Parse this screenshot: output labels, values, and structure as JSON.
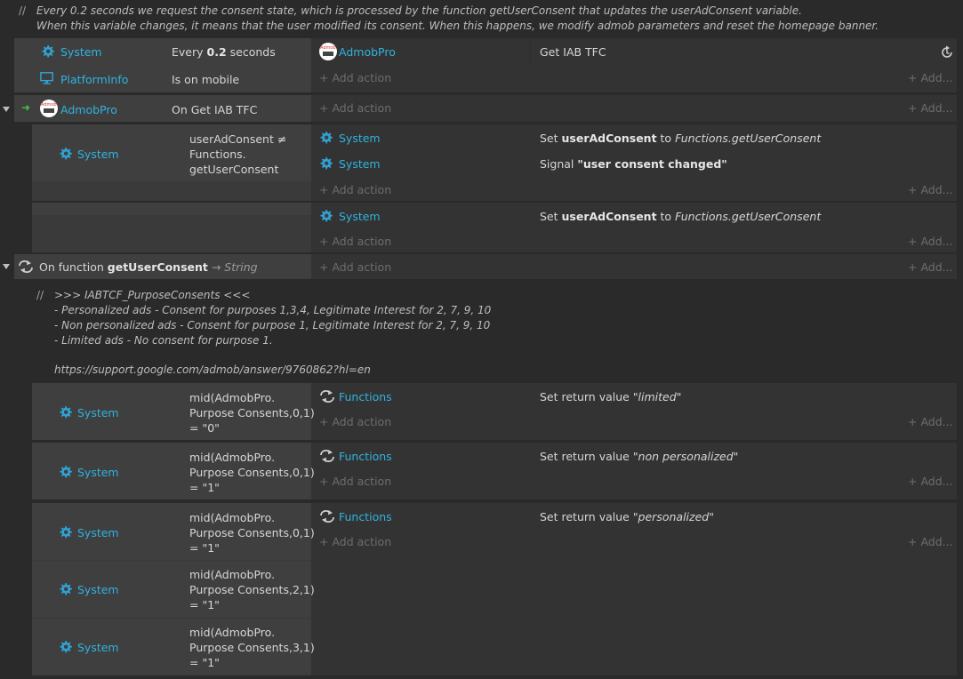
{
  "comment1": {
    "line1": "Every 0.2 seconds we request the consent state, which is processed by the function getUserConsent that updates the userAdConsent variable.",
    "line2": "When this variable changes, it means that the user modified its consent. When this happens, we modify admob parameters and reset the homepage banner."
  },
  "event1": {
    "cond1_obj": "System",
    "cond1_pre": "Every ",
    "cond1_val": "0.2",
    "cond1_post": " seconds",
    "cond2_obj": "PlatformInfo",
    "cond2_text": "Is on mobile",
    "action_obj": "AdmobPro",
    "action_text": "Get IAB TFC",
    "add_action": "Add action",
    "add_more": "Add..."
  },
  "event2": {
    "arrow": "➜",
    "cond_obj": "AdmobPro",
    "cond_text": "On Get IAB TFC",
    "add_action": "Add action",
    "add_more": "Add..."
  },
  "sub1": {
    "cond_obj": "System",
    "cond_l1": "userAdConsent ≠",
    "cond_l2": "Functions.",
    "cond_l3": "getUserConsent",
    "a1_obj": "System",
    "a1_pre": "Set ",
    "a1_var": "userAdConsent",
    "a1_mid": " to ",
    "a1_val": "Functions.getUserConsent",
    "a2_obj": "System",
    "a2_pre": "Signal ",
    "a2_val": "\"user consent changed\"",
    "add_action": "Add action",
    "add_more": "Add..."
  },
  "sub2": {
    "a1_obj": "System",
    "a1_pre": "Set ",
    "a1_var": "userAdConsent",
    "a1_mid": " to ",
    "a1_val": "Functions.getUserConsent",
    "add_action": "Add action",
    "add_more": "Add..."
  },
  "func": {
    "pre": "On function ",
    "name": "getUserConsent",
    "arrow": " → ",
    "type": "String",
    "add_action": "Add action",
    "add_more": "Add..."
  },
  "comment2": {
    "l1": ">>> IABTCF_PurposeConsents <<<",
    "l2": "- Personalized ads - Consent for purposes 1,3,4, Legitimate Interest for 2, 7, 9, 10",
    "l3": "- Non personalized ads - Consent for purpose 1, Legitimate Interest for 2, 7, 9, 10",
    "l4": "- Limited ads - No consent for purpose 1.",
    "l5": "https://support.google.com/admob/answer/9760862?hl=en"
  },
  "f1": {
    "cond_obj": "System",
    "c_l1": "mid(AdmobPro.",
    "c_l2": "Purpose Consents,0,1)",
    "c_l3": "= \"0\"",
    "act_obj": "Functions",
    "act_pre": "Set return value ",
    "act_val": "\"limited\"",
    "add_action": "Add action",
    "add_more": "Add..."
  },
  "f2": {
    "cond_obj": "System",
    "c_l1": "mid(AdmobPro.",
    "c_l2": "Purpose Consents,0,1)",
    "c_l3": "= \"1\"",
    "act_obj": "Functions",
    "act_pre": "Set return value ",
    "act_val": "\"non personalized\"",
    "add_action": "Add action",
    "add_more": "Add..."
  },
  "f3": {
    "c1_obj": "System",
    "c1_l1": "mid(AdmobPro.",
    "c1_l2": "Purpose Consents,0,1)",
    "c1_l3": "= \"1\"",
    "c2_obj": "System",
    "c2_l1": "mid(AdmobPro.",
    "c2_l2": "Purpose Consents,2,1)",
    "c2_l3": "= \"1\"",
    "c3_obj": "System",
    "c3_l1": "mid(AdmobPro.",
    "c3_l2": "Purpose Consents,3,1)",
    "c3_l3": "= \"1\"",
    "act_obj": "Functions",
    "act_pre": "Set return value ",
    "act_val": "\"personalized\"",
    "add_action": "Add action",
    "add_more": "Add..."
  },
  "comment_marker": "//",
  "add_plus": "+",
  "admob_logo_text": "Admob"
}
